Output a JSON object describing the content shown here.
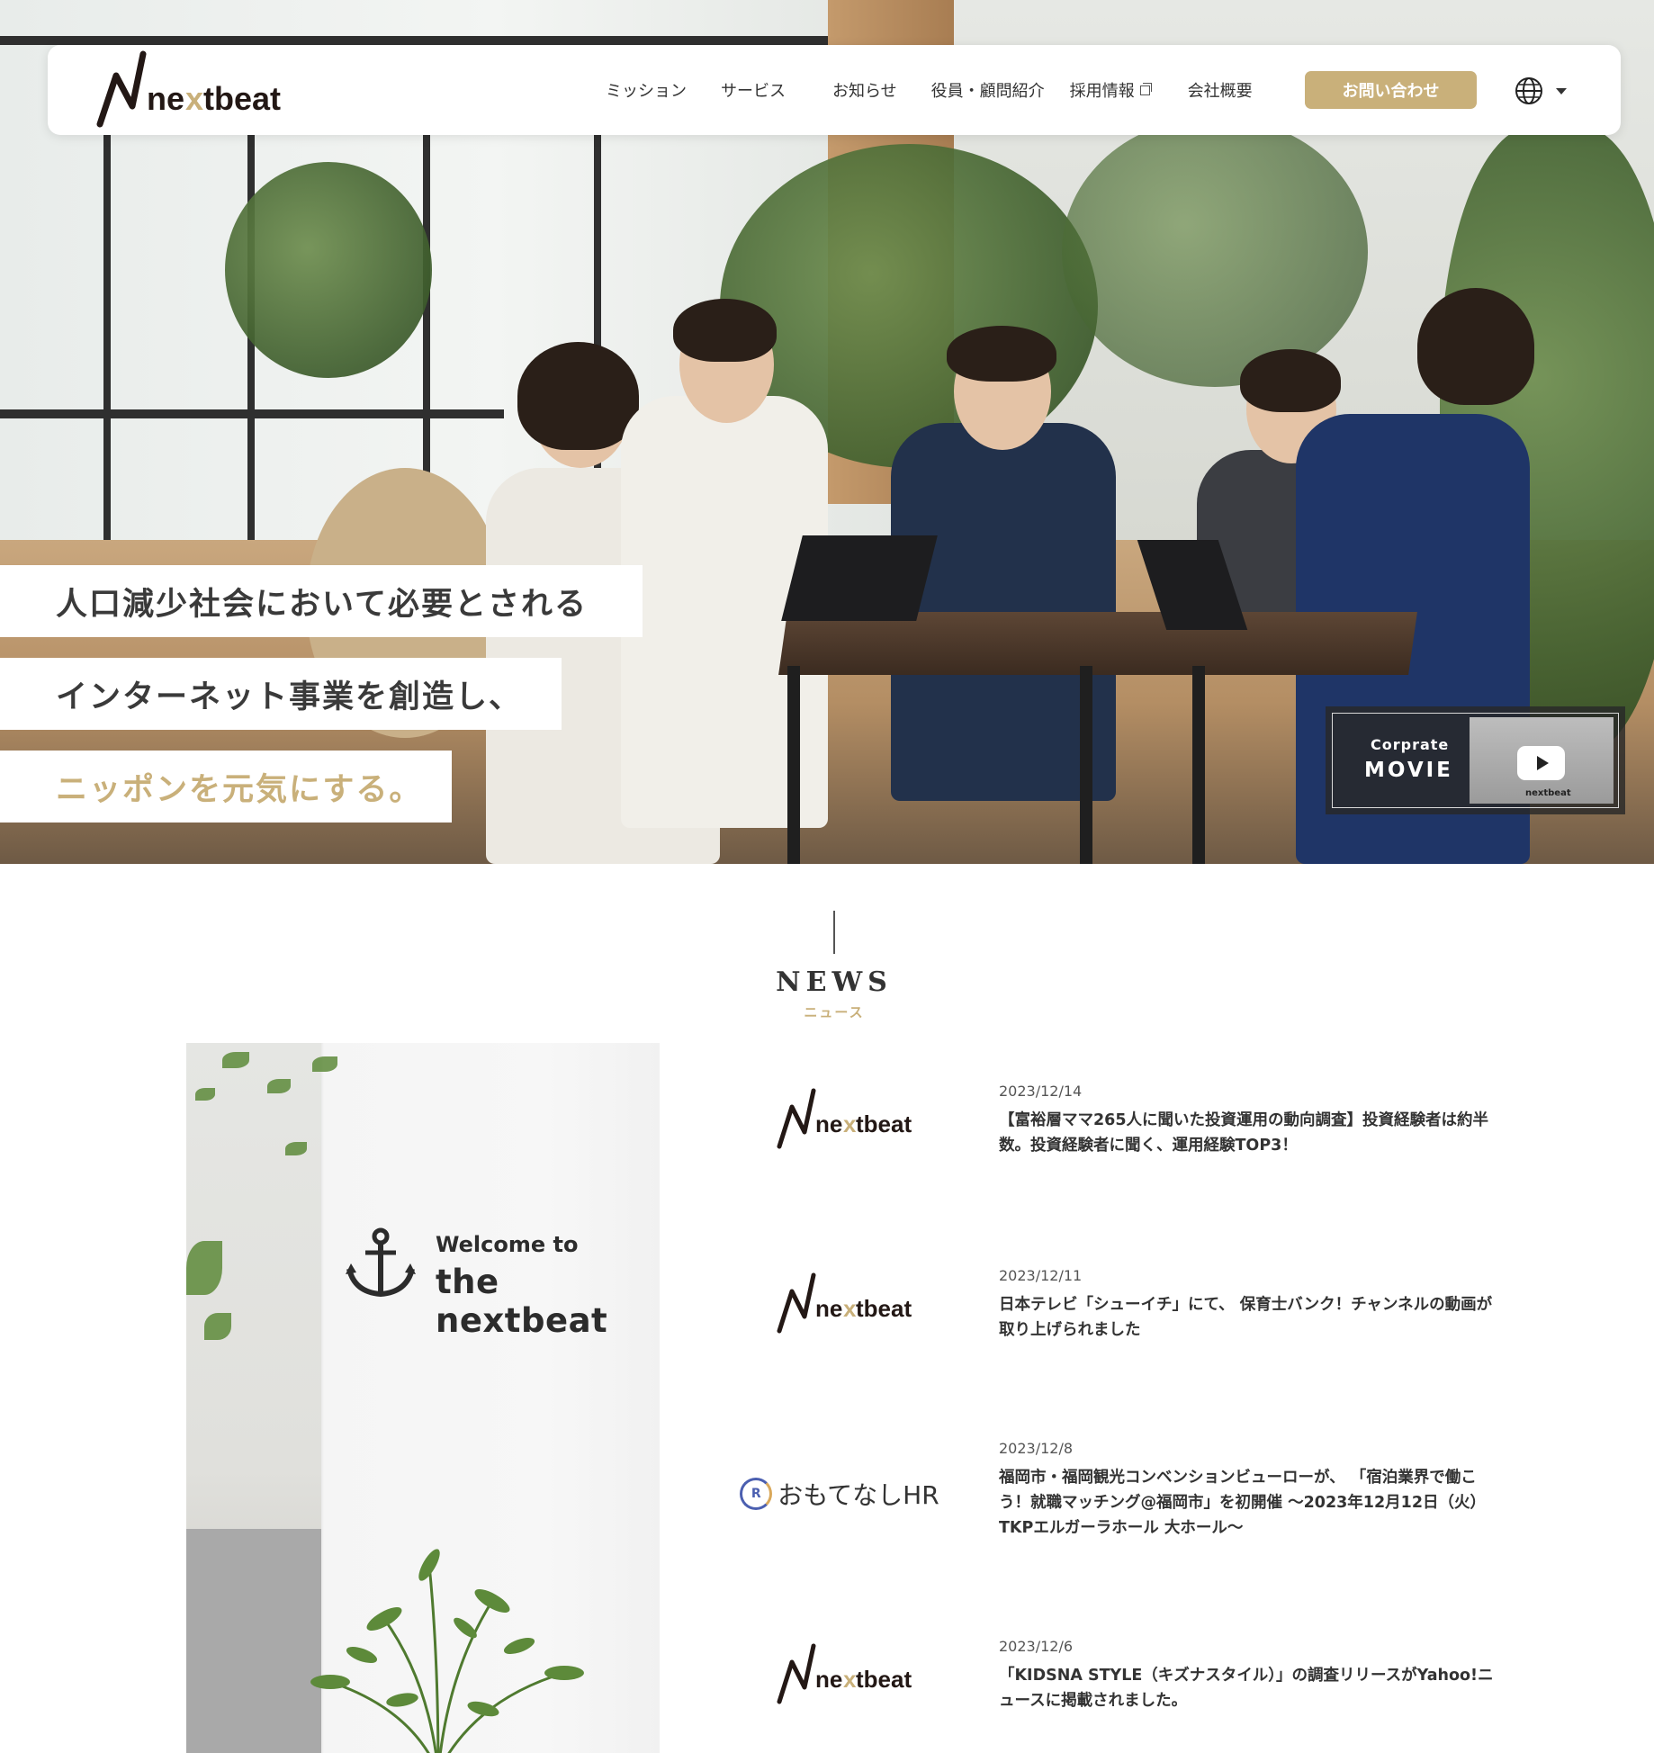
{
  "brand": {
    "name": "nextbeat",
    "accent_color": "#c9b07a"
  },
  "header": {
    "nav": [
      {
        "label": "ミッション"
      },
      {
        "label": "サービス"
      },
      {
        "label": "お知らせ"
      },
      {
        "label": "役員・顧問紹介"
      },
      {
        "label": "採用情報",
        "icon": "external-link-icon"
      },
      {
        "label": "会社概要"
      }
    ],
    "contact_label": "お問い合わせ",
    "language_icon": "globe-icon"
  },
  "hero": {
    "lines": [
      "人口減少社会において必要とされる",
      "インターネット事業を創造し、",
      "ニッポンを元気にする。"
    ],
    "movie": {
      "small": "Corprate",
      "big": "MOVIE",
      "thumb_logo": "nextbeat"
    }
  },
  "news": {
    "title": "NEWS",
    "subtitle": "ニュース",
    "welcome": {
      "line1": "Welcome to",
      "line2": "the nextbeat"
    },
    "items": [
      {
        "logo": "nextbeat",
        "date": "2023/12/14",
        "text": "【富裕層ママ265人に聞いた投資運用の動向調査】投資経験者は約半数。投資経験者に聞く、運用経験TOP3！"
      },
      {
        "logo": "nextbeat",
        "date": "2023/12/11",
        "text": "日本テレビ「シューイチ」にて、 保育士バンク！チャンネルの動画が取り上げられました"
      },
      {
        "logo": "おもてなしHR",
        "date": "2023/12/8",
        "text": "福岡市・福岡観光コンベンションビューローが、 「宿泊業界で働こう！就職マッチング@福岡市」を初開催 ～2023年12月12日（火）TKPエルガーラホール 大ホール～"
      },
      {
        "logo": "nextbeat",
        "date": "2023/12/6",
        "text": "「KIDSNA STYLE（キズナスタイル）」の調査リリースがYahoo!ニュースに掲載されました。"
      }
    ]
  }
}
